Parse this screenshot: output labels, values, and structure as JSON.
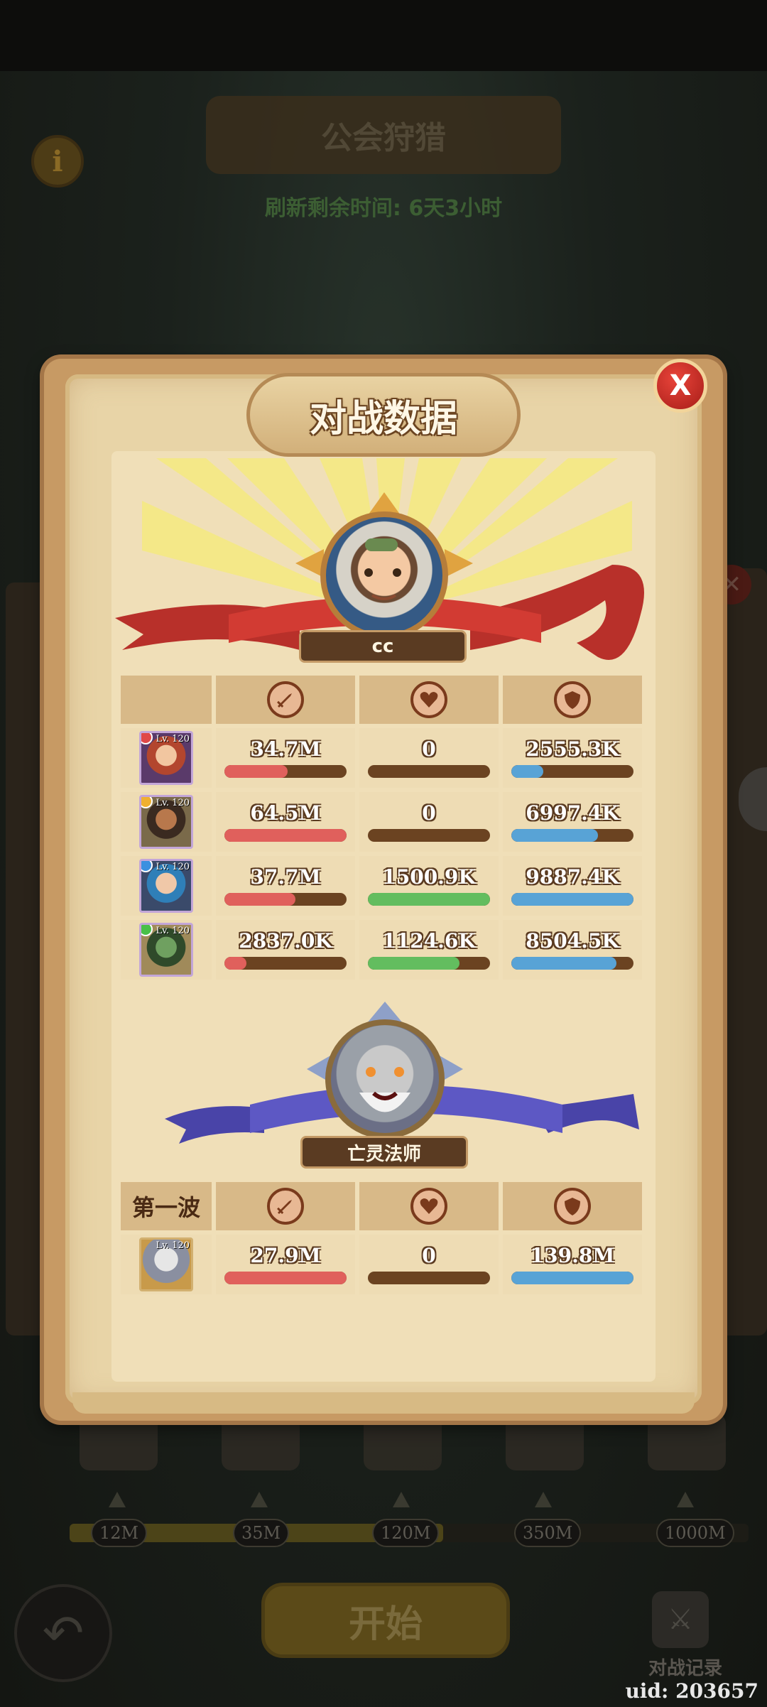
{
  "background": {
    "title": "公会狩猎",
    "refresh_timer": "刷新剩余时间: 6天3小时",
    "info_icon": "i",
    "milestones": [
      "12M",
      "35M",
      "120M",
      "350M",
      "1000M"
    ],
    "start_button": "开始",
    "records_label": "对战记录",
    "uid": "uid: 203657",
    "progress_fraction": 0.55
  },
  "dialog": {
    "title": "对战数据",
    "close_label": "X",
    "player": {
      "name": "cc",
      "heroes": [
        {
          "level": "Lv. 120",
          "gem_color": "#e04848",
          "damage": "34.7M",
          "damage_fill": 0.52,
          "heal": "0",
          "heal_fill": 0,
          "absorb": "2555.3K",
          "absorb_fill": 0.26
        },
        {
          "level": "Lv. 120",
          "gem_color": "#f0b030",
          "damage": "64.5M",
          "damage_fill": 1.0,
          "heal": "0",
          "heal_fill": 0,
          "absorb": "6997.4K",
          "absorb_fill": 0.71
        },
        {
          "level": "Lv. 120",
          "gem_color": "#3a90e0",
          "damage": "37.7M",
          "damage_fill": 0.58,
          "heal": "1500.9K",
          "heal_fill": 1.0,
          "absorb": "9887.4K",
          "absorb_fill": 1.0
        },
        {
          "level": "Lv. 120",
          "gem_color": "#48c048",
          "damage": "2837.0K",
          "damage_fill": 0.18,
          "heal": "1124.6K",
          "heal_fill": 0.75,
          "absorb": "8504.5K",
          "absorb_fill": 0.86
        }
      ]
    },
    "boss": {
      "name": "亡灵法师",
      "wave_label": "第一波",
      "level": "Lv. 120",
      "damage": "27.9M",
      "damage_fill": 1.0,
      "heal": "0",
      "heal_fill": 0,
      "absorb": "139.8M",
      "absorb_fill": 1.0
    },
    "stat_icons": [
      "sword-icon",
      "heart-icon",
      "shield-icon"
    ]
  }
}
